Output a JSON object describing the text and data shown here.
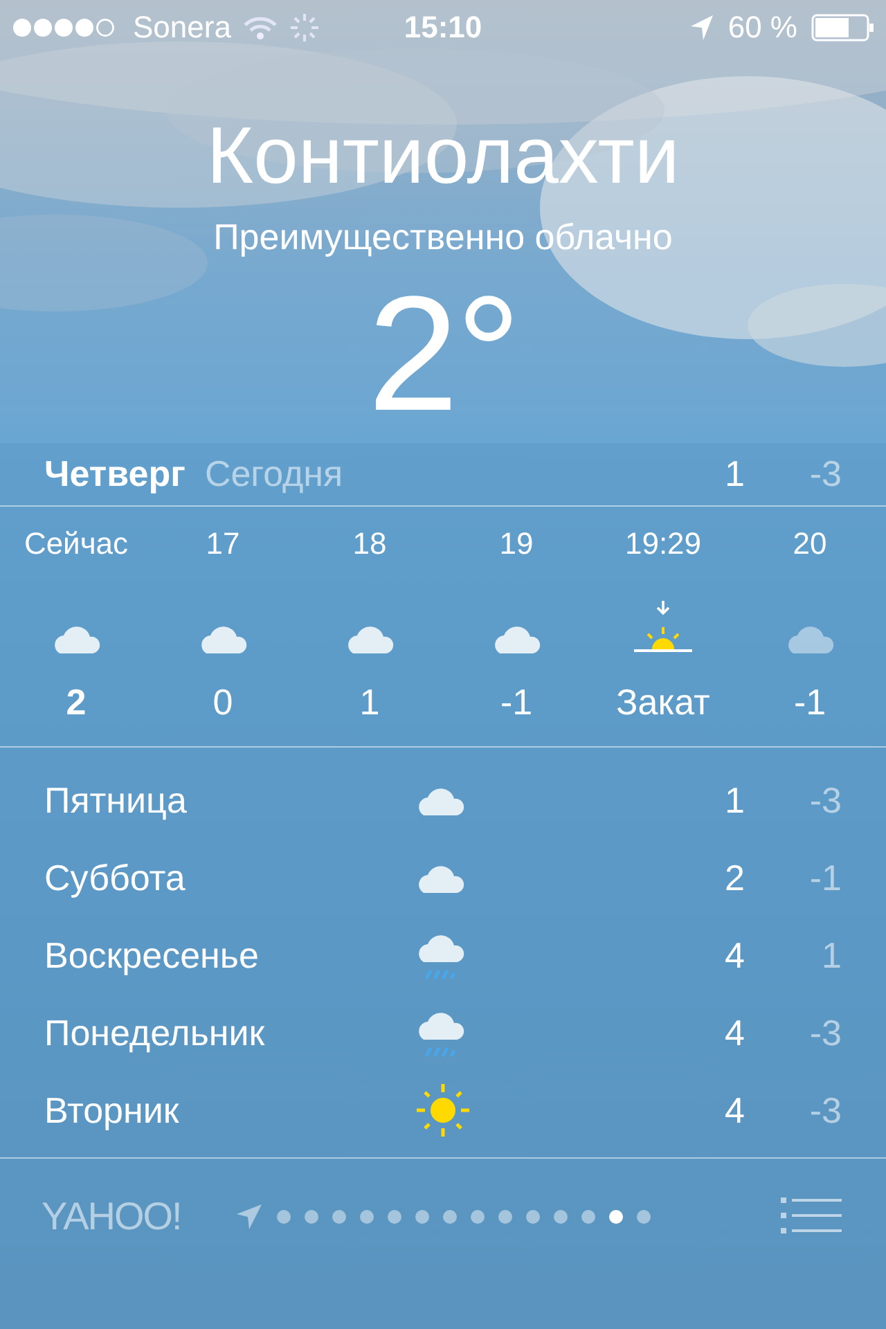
{
  "status_bar": {
    "carrier": "Sonera",
    "time": "15:10",
    "battery": "60 %"
  },
  "city": "Контиолахти",
  "condition": "Преимущественно облачно",
  "temperature": "2°",
  "today": {
    "day": "Четверг",
    "label": "Сегодня",
    "high": "1",
    "low": "-3"
  },
  "hourly": [
    {
      "time": "Сейчас",
      "kind": "cloudy",
      "value": "2",
      "dimmed": false
    },
    {
      "time": "17",
      "kind": "cloudy",
      "value": "0",
      "dimmed": false
    },
    {
      "time": "18",
      "kind": "cloudy",
      "value": "1",
      "dimmed": false
    },
    {
      "time": "19",
      "kind": "cloudy",
      "value": "-1",
      "dimmed": false
    },
    {
      "time": "19:29",
      "kind": "sunset",
      "value": "Закат",
      "dimmed": false
    },
    {
      "time": "20",
      "kind": "cloudy",
      "value": "-1",
      "dimmed": true
    }
  ],
  "daily": [
    {
      "day": "Пятница",
      "kind": "cloudy",
      "high": "1",
      "low": "-3"
    },
    {
      "day": "Суббота",
      "kind": "cloudy",
      "high": "2",
      "low": "-1"
    },
    {
      "day": "Воскресенье",
      "kind": "rain",
      "high": "4",
      "low": "1"
    },
    {
      "day": "Понедельник",
      "kind": "rain",
      "high": "4",
      "low": "-3"
    },
    {
      "day": "Вторник",
      "kind": "sunny",
      "high": "4",
      "low": "-3"
    }
  ],
  "footer": {
    "logo": "YAHOO!",
    "pages": [
      {
        "selected": false
      },
      {
        "selected": false
      },
      {
        "selected": false
      },
      {
        "selected": false
      },
      {
        "selected": false
      },
      {
        "selected": false
      },
      {
        "selected": false
      },
      {
        "selected": false
      },
      {
        "selected": false
      },
      {
        "selected": false
      },
      {
        "selected": false
      },
      {
        "selected": false
      },
      {
        "selected": true
      },
      {
        "selected": false
      }
    ]
  }
}
